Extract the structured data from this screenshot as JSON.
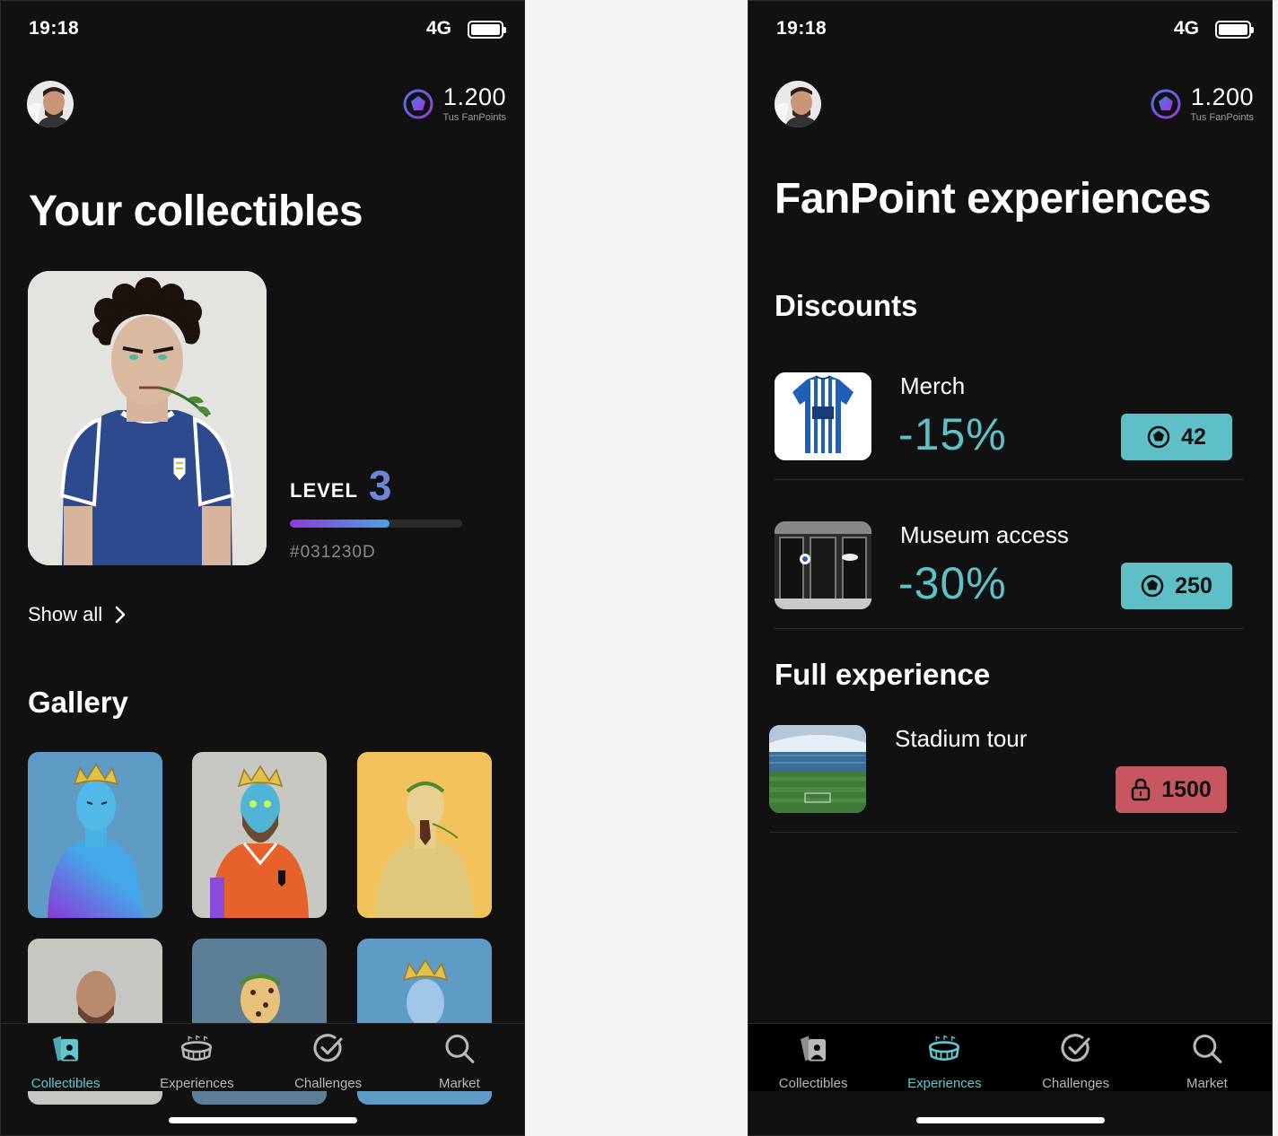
{
  "status": {
    "time": "19:18",
    "network": "4G"
  },
  "points": {
    "value": "1.200",
    "label": "Tus FanPoints"
  },
  "collectibles_screen": {
    "title": "Your collectibles",
    "level_label": "LEVEL",
    "level_number": "3",
    "level_progress": 0.58,
    "token_id": "#031230D",
    "show_all": "Show all",
    "gallery_heading": "Gallery"
  },
  "experiences_screen": {
    "title": "FanPoint experiences",
    "discounts_heading": "Discounts",
    "full_heading": "Full experience",
    "items": [
      {
        "title": "Merch",
        "discount": "-15%",
        "cost": "42",
        "locked": false
      },
      {
        "title": "Museum access",
        "discount": "-30%",
        "cost": "250",
        "locked": false
      }
    ],
    "full_items": [
      {
        "title": "Stadium tour",
        "discount": "",
        "cost": "1500",
        "locked": true
      }
    ]
  },
  "tabs": [
    {
      "label": "Collectibles",
      "icon": "cards-icon"
    },
    {
      "label": "Experiences",
      "icon": "stadium-icon"
    },
    {
      "label": "Challenges",
      "icon": "check-circle-icon"
    },
    {
      "label": "Market",
      "icon": "search-icon"
    }
  ],
  "colors": {
    "accent": "#5fbfc7",
    "locked": "#c65660",
    "background": "#111111"
  }
}
